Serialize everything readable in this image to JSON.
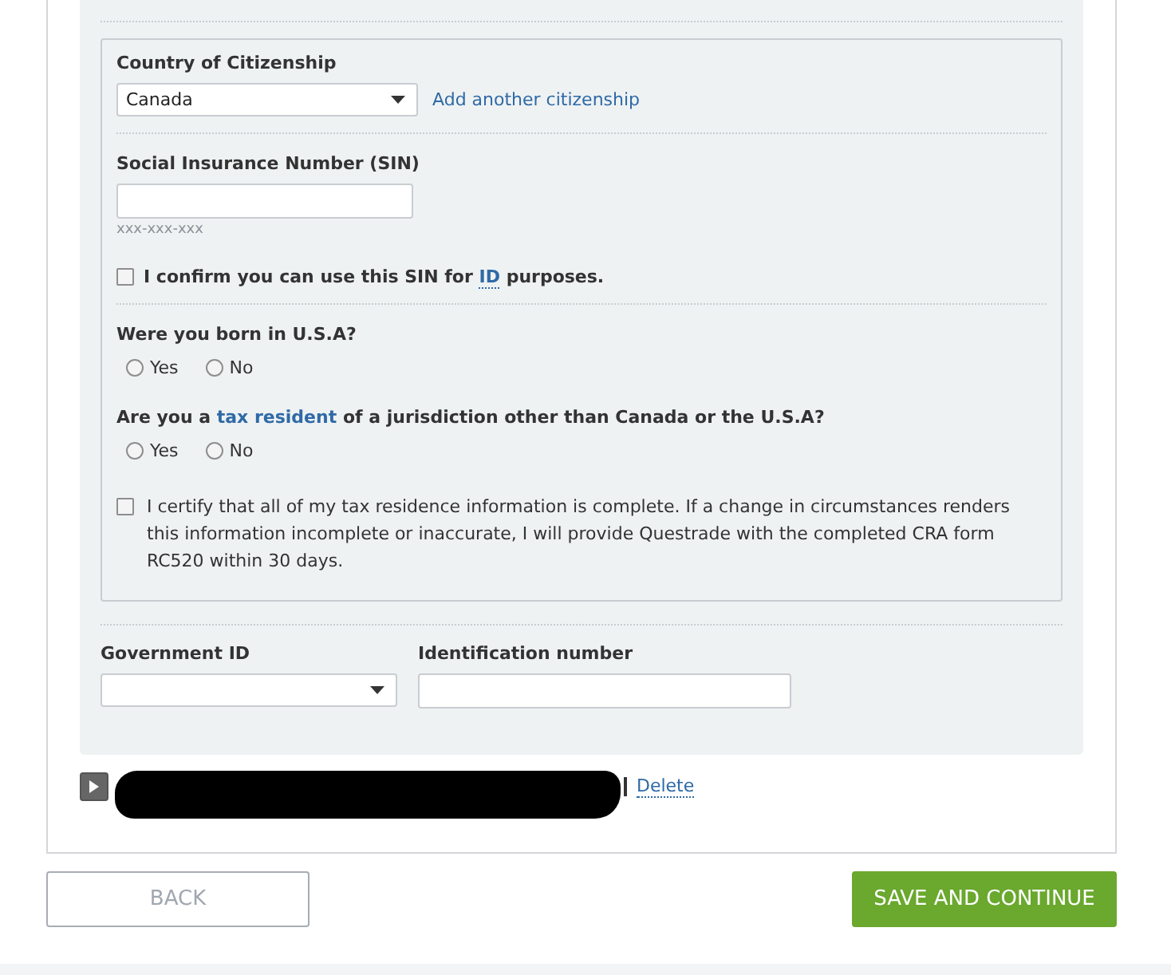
{
  "citizenship": {
    "label": "Country of Citizenship",
    "value": "Canada",
    "link": "Add another citizenship"
  },
  "sin": {
    "label": "Social Insurance Number (SIN)",
    "hint": "xxx-xxx-xxx"
  },
  "sin_confirm": {
    "checked": false,
    "before": "I confirm you can use this SIN for ",
    "link": "ID",
    "after": " purposes."
  },
  "born_usa": {
    "before": "Were you born in U.S.A?",
    "options": [
      {
        "label": "Yes",
        "selected": false
      },
      {
        "label": "No",
        "selected": false
      }
    ]
  },
  "tax_resident": {
    "before": "Are you a ",
    "link": "tax resident",
    "after": " of a jurisdiction other than Canada or the U.S.A?",
    "options": [
      {
        "label": "Yes",
        "selected": false
      },
      {
        "label": "No",
        "selected": false
      }
    ]
  },
  "certify": {
    "checked": false,
    "text": "I certify that all of my tax residence information is complete. If a change in circumstances renders this information incomplete or inaccurate, I will provide Questrade with the completed CRA form RC520 within 30 days."
  },
  "government_id": {
    "label": "Government ID"
  },
  "identification_number": {
    "label": "Identification number"
  },
  "item_row": {
    "expanded": false,
    "link": "Delete"
  },
  "buttons": {
    "back": "BACK",
    "save": "SAVE AND CONTINUE"
  }
}
